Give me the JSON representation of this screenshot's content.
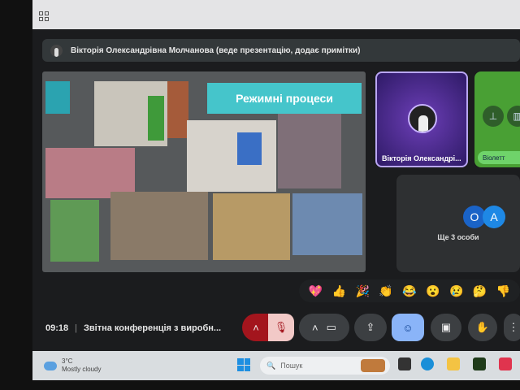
{
  "presenter_banner": "Вікторія Олександрівна Молчанова (веде презентацію, додає примітки)",
  "slide": {
    "title": "Режимні процеси"
  },
  "participants": {
    "main_tile_name": "Вікторія Олександрі...",
    "green_tile_name": "Віолетт",
    "more_avatars": [
      "О",
      "А"
    ],
    "more_label": "Ще 3 особи"
  },
  "reactions": [
    "💖",
    "👍",
    "🎉",
    "👏",
    "😂",
    "😮",
    "😢",
    "🤔",
    "👎"
  ],
  "meeting": {
    "time": "09:18",
    "separator": "|",
    "title": "Звітна конференція з виробн..."
  },
  "taskbar": {
    "temperature": "3°C",
    "weather": "Mostly cloudy",
    "search_placeholder": "Пошук"
  },
  "colors": {
    "accent": "#45c5cb",
    "mic_off": "#a3151d",
    "emoji_active": "#8ab4f8"
  }
}
